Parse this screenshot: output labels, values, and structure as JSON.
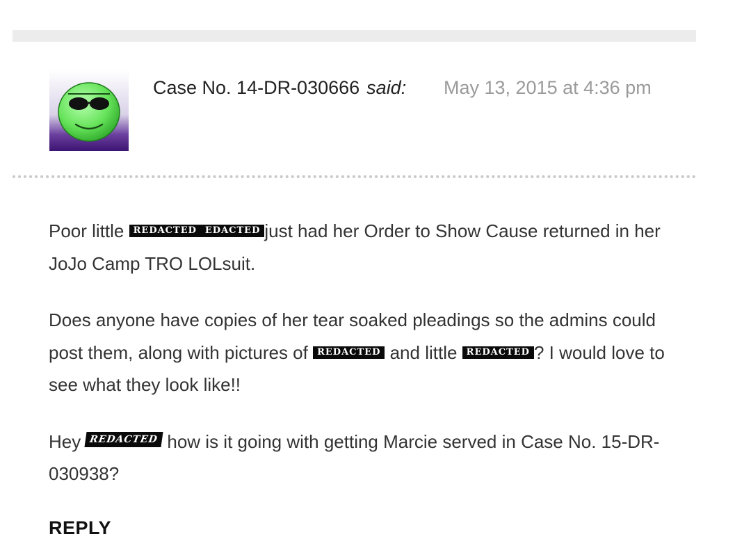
{
  "comment": {
    "author": "Case No. 14-DR-030666",
    "said_label": "said:",
    "date": "May 13, 2015 at 4:36 pm",
    "avatar_icon": "sunglasses-smiley-icon",
    "paragraph1": {
      "t1": "Poor little ",
      "redact1": "REDACTED",
      "redact2": "EDACTED",
      "t2": "just had her Order to Show Cause returned in her JoJo Camp TRO LOLsuit."
    },
    "paragraph2": {
      "t1": "Does anyone have copies of her tear soaked pleadings so the admins could post them, along with pictures of ",
      "redact1": "REDACTED",
      "t2": " and little ",
      "redact2": "REDACTED",
      "t3": "? I would love to see what they look like!!"
    },
    "paragraph3": {
      "t1": "Hey ",
      "redact1": "REDACTED",
      "t2": " how is it going with getting Marcie served in Case No. 15-DR-030938?"
    },
    "reply_label": "REPLY"
  },
  "colors": {
    "text": "#333333",
    "date": "#9a9a9a",
    "separator": "#c9c9c9",
    "top_bar": "#ececec",
    "redaction": "#0a0a0a"
  }
}
